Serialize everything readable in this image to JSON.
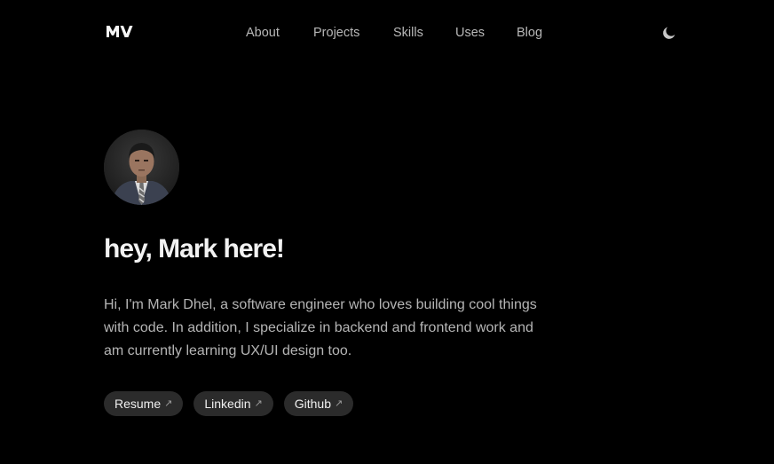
{
  "header": {
    "logo_text": "MV",
    "nav": [
      {
        "label": "About"
      },
      {
        "label": "Projects"
      },
      {
        "label": "Skills"
      },
      {
        "label": "Uses"
      },
      {
        "label": "Blog"
      }
    ],
    "theme_toggle_icon": "moon-icon"
  },
  "hero": {
    "avatar_icon": "profile-photo",
    "title": "hey, Mark here!",
    "intro": "Hi, I'm Mark Dhel, a software engineer who loves building cool things with code. In addition, I specialize in backend and frontend work and am currently learning UX/UI design too.",
    "links": [
      {
        "label": "Resume",
        "icon": "external-arrow-icon"
      },
      {
        "label": "Linkedin",
        "icon": "external-arrow-icon"
      },
      {
        "label": "Github",
        "icon": "external-arrow-icon"
      }
    ]
  },
  "colors": {
    "background": "#000000",
    "text_primary": "#f2f2f2",
    "text_secondary": "#b5b5b5",
    "pill_background": "#2b2b2b"
  }
}
